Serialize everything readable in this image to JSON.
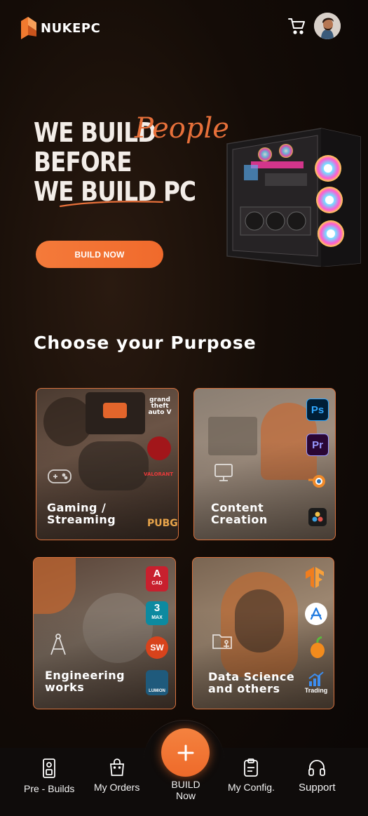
{
  "app": {
    "brand": "NUKEPC"
  },
  "hero": {
    "line1": "WE BUILD",
    "line2": "BEFORE",
    "line3": "WE BUILD PC",
    "script_word": "People",
    "cta_label": "BUILD NOW"
  },
  "purpose": {
    "title": "Choose your Purpose",
    "cards": [
      {
        "line1": "Gaming /",
        "line2": "Streaming",
        "apps": [
          "grand theft auto V",
          "Red Dead Redemption",
          "VALORANT",
          "PUBG"
        ]
      },
      {
        "line1": "Content",
        "line2": "Creation",
        "apps": [
          "Ps",
          "Pr",
          "blender-icon",
          "davinci-resolve-icon"
        ]
      },
      {
        "line1": "Engineering",
        "line2": "works",
        "apps": [
          "A",
          "CAD",
          "3",
          "MAX",
          "SW",
          "LUMION"
        ]
      },
      {
        "line1": "Data Science",
        "line2": "and others",
        "apps": [
          "tensorflow-icon",
          "app-store-icon",
          "fl-studio-icon",
          "Trading"
        ]
      }
    ]
  },
  "bottom_nav": {
    "prebuilds": "Pre - Builds",
    "orders": "My Orders",
    "build_line1": "BUILD",
    "build_line2": "Now",
    "config": "My Config.",
    "support": "Support"
  },
  "colors": {
    "accent": "#F0732F",
    "background": "#140C07",
    "nav_background": "#0F0C0B"
  }
}
